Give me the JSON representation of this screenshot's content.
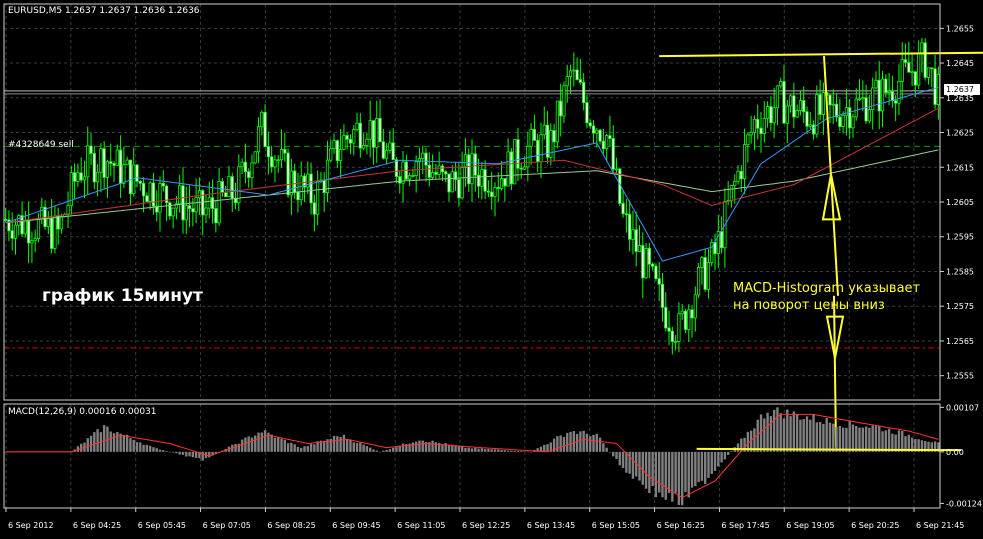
{
  "chart_window": {
    "header": "EURUSD,M5  1.2637 1.2637 1.2636 1.2636",
    "order_label": "#4328649 sell",
    "current_price_tag": "1.2637",
    "note_text": "график 15минут",
    "annotation_lines": [
      "MACD-Histogram указывает",
      "на поворот цены вниз"
    ],
    "macd_header": "MACD(12,26,9) 0.00016 0.00031"
  },
  "colors": {
    "background": "#000000",
    "grid": "#2f3f3f",
    "bull_candle": "#00ff00",
    "bear_candle": "#ffffff",
    "ma_fast": "#3399ff",
    "ma_mid": "#cc3333",
    "ma_slow": "#99cc99",
    "annotation": "#ffff33",
    "order_line": "#009900",
    "stop_line": "#cc0000",
    "macd_hist": "#808080",
    "macd_signal": "#ff3333"
  },
  "chart_data": [
    {
      "type": "candlestick",
      "symbol": "EURUSD",
      "timeframe": "M5",
      "y_ticks": [
        1.2655,
        1.2645,
        1.2635,
        1.2625,
        1.2615,
        1.2605,
        1.2595,
        1.2585,
        1.2575,
        1.2565,
        1.2555
      ],
      "ylim": [
        1.2548,
        1.2662
      ],
      "x_ticks": [
        "6 Sep 2012",
        "6 Sep 04:25",
        "6 Sep 05:45",
        "6 Sep 07:05",
        "6 Sep 08:25",
        "6 Sep 09:45",
        "6 Sep 11:05",
        "6 Sep 12:25",
        "6 Sep 13:45",
        "6 Sep 15:05",
        "6 Sep 16:25",
        "6 Sep 17:45",
        "6 Sep 19:05",
        "6 Sep 20:25",
        "6 Sep 21:45"
      ],
      "close_keypoints": [
        [
          0,
          1.26
        ],
        [
          10,
          1.2598
        ],
        [
          16,
          1.2596
        ],
        [
          22,
          1.2614
        ],
        [
          30,
          1.2618
        ],
        [
          40,
          1.2611
        ],
        [
          50,
          1.2606
        ],
        [
          60,
          1.2602
        ],
        [
          70,
          1.2608
        ],
        [
          78,
          1.2626
        ],
        [
          86,
          1.2612
        ],
        [
          94,
          1.2606
        ],
        [
          102,
          1.2622
        ],
        [
          110,
          1.2628
        ],
        [
          118,
          1.2615
        ],
        [
          126,
          1.2618
        ],
        [
          134,
          1.261
        ],
        [
          142,
          1.2614
        ],
        [
          150,
          1.2612
        ],
        [
          158,
          1.262
        ],
        [
          166,
          1.2622
        ],
        [
          172,
          1.2642
        ],
        [
          178,
          1.263
        ],
        [
          183,
          1.2624
        ],
        [
          188,
          1.26
        ],
        [
          194,
          1.2588
        ],
        [
          200,
          1.2575
        ],
        [
          205,
          1.2568
        ],
        [
          210,
          1.258
        ],
        [
          216,
          1.259
        ],
        [
          222,
          1.261
        ],
        [
          228,
          1.2628
        ],
        [
          236,
          1.2634
        ],
        [
          244,
          1.263
        ],
        [
          252,
          1.2631
        ],
        [
          260,
          1.2633
        ],
        [
          268,
          1.2637
        ],
        [
          276,
          1.2643
        ],
        [
          280,
          1.2646
        ],
        [
          284,
          1.2636
        ]
      ],
      "ma_fast_keypoints": [
        [
          0,
          1.2599
        ],
        [
          40,
          1.2612
        ],
        [
          80,
          1.2607
        ],
        [
          120,
          1.2617
        ],
        [
          150,
          1.2616
        ],
        [
          180,
          1.2622
        ],
        [
          200,
          1.2588
        ],
        [
          215,
          1.2592
        ],
        [
          230,
          1.2616
        ],
        [
          250,
          1.2629
        ],
        [
          284,
          1.2638
        ]
      ],
      "ma_mid_keypoints": [
        [
          0,
          1.2599
        ],
        [
          60,
          1.2607
        ],
        [
          120,
          1.2614
        ],
        [
          170,
          1.2617
        ],
        [
          200,
          1.261
        ],
        [
          215,
          1.2604
        ],
        [
          240,
          1.261
        ],
        [
          260,
          1.262
        ],
        [
          284,
          1.2632
        ]
      ],
      "ma_slow_keypoints": [
        [
          0,
          1.2599
        ],
        [
          60,
          1.2605
        ],
        [
          120,
          1.2611
        ],
        [
          180,
          1.2614
        ],
        [
          215,
          1.2608
        ],
        [
          240,
          1.2611
        ],
        [
          284,
          1.262
        ]
      ],
      "order_price": 1.2621,
      "stop_price": 1.2563,
      "current_price": 1.2637,
      "annotation_lines": [
        [
          [
            1.2647,
            0.7
          ],
          [
            1.2648,
            1.0
          ]
        ],
        [
          [
            7e-05,
            0.74
          ],
          [
            4e-05,
            0.98
          ]
        ]
      ]
    },
    {
      "type": "bar",
      "name": "MACD(12,26,9)",
      "y_ticks": [
        0.00107,
        0.0,
        -0.00124
      ],
      "ylim": [
        -0.00135,
        0.00115
      ],
      "hist_keypoints": [
        [
          0,
          0.0
        ],
        [
          20,
          0.0
        ],
        [
          30,
          0.0006
        ],
        [
          45,
          0.0001
        ],
        [
          60,
          -0.0002
        ],
        [
          78,
          0.0005
        ],
        [
          90,
          0.0001
        ],
        [
          102,
          0.0004
        ],
        [
          114,
          0.0
        ],
        [
          126,
          0.0003
        ],
        [
          140,
          0.0001
        ],
        [
          160,
          0.0
        ],
        [
          172,
          0.0005
        ],
        [
          180,
          0.0004
        ],
        [
          188,
          -0.0004
        ],
        [
          198,
          -0.001
        ],
        [
          206,
          -0.0012
        ],
        [
          214,
          -0.0006
        ],
        [
          222,
          0.0001
        ],
        [
          232,
          0.001
        ],
        [
          240,
          0.0009
        ],
        [
          252,
          0.0007
        ],
        [
          265,
          0.0006
        ],
        [
          275,
          0.0004
        ],
        [
          284,
          0.0002
        ]
      ],
      "signal_keypoints": [
        [
          0,
          0.0
        ],
        [
          20,
          0.0
        ],
        [
          35,
          0.0004
        ],
        [
          50,
          0.0002
        ],
        [
          62,
          -0.0001
        ],
        [
          80,
          0.0004
        ],
        [
          92,
          0.0002
        ],
        [
          104,
          0.0003
        ],
        [
          116,
          0.0001
        ],
        [
          128,
          0.0002
        ],
        [
          145,
          0.0001
        ],
        [
          165,
          0.0
        ],
        [
          176,
          0.0003
        ],
        [
          186,
          0.0002
        ],
        [
          196,
          -0.0006
        ],
        [
          206,
          -0.0011
        ],
        [
          216,
          -0.0007
        ],
        [
          226,
          0.0002
        ],
        [
          236,
          0.0009
        ],
        [
          246,
          0.0009
        ],
        [
          260,
          0.0007
        ],
        [
          275,
          0.0005
        ],
        [
          284,
          0.0003
        ]
      ]
    }
  ]
}
